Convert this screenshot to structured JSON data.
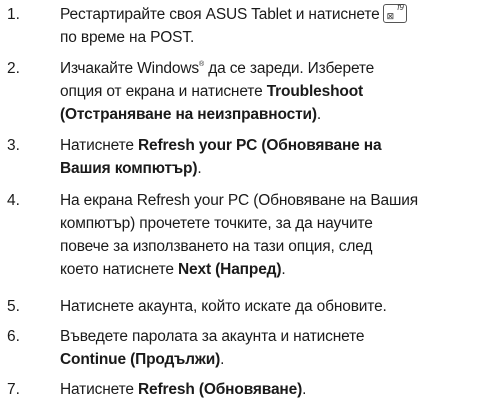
{
  "steps": [
    {
      "number": "1.",
      "line1_before_icon": "Рестартирайте своя ASUS Tablet и натиснете",
      "key_icon": {
        "label": "f9",
        "glyph": "⊠",
        "icon": "f9-key-icon"
      },
      "line2": "по време на POST."
    },
    {
      "number": "2.",
      "line1_a": "Изчакайте Windows",
      "registered_mark": "®",
      "line1_b": " да се зареди. Изберете",
      "line2": "опция от екрана и натиснете ",
      "bold_a": "Troubleshoot",
      "bold_b": "(Отстраняване на неизправности)",
      "tail": "."
    },
    {
      "number": "3.",
      "line1": "Натиснете ",
      "bold_a": "Refresh your PC (Обновяване на",
      "bold_b": "Вашия компютър)",
      "tail": "."
    },
    {
      "number": "4.",
      "line1": "На екрана Refresh your PC (Обновяване на Вашия",
      "line2": "компютър) прочетете точките, за да научите",
      "line3": "повече за използването на тази опция, след",
      "line4": "което натиснете ",
      "bold": "Next (Напред)",
      "tail": "."
    },
    {
      "number": "5.",
      "line1": "Натиснете акаунта, който искате да обновите."
    },
    {
      "number": "6.",
      "line1": "Въведете паролата за акаунта и натиснете",
      "bold": "Continue (Продължи)",
      "tail": "."
    },
    {
      "number": "7.",
      "line1": "Натиснете ",
      "bold": "Refresh (Обновяване)",
      "tail": "."
    }
  ]
}
